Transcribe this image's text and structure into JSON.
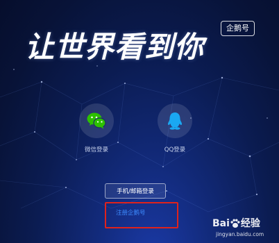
{
  "hero": {
    "title": "让世界看到你"
  },
  "brand": {
    "badge": "企鹅号"
  },
  "login": {
    "wechat_label": "微信登录",
    "qq_label": "QQ登录",
    "phone_email_label": "手机/邮箱登录",
    "register_label": "注册企鹅号"
  },
  "icons": {
    "wechat": "wechat-icon",
    "qq": "qq-icon"
  },
  "colors": {
    "background": "#0b1c52",
    "wechat": "#2dc100",
    "qq": "#1aa8f2",
    "register_link": "#3d8bff",
    "highlight_frame": "#e0221b"
  },
  "watermark": {
    "brand_text": "Bai",
    "brand_suffix": "经验",
    "url": "jingyan.baidu.com"
  }
}
